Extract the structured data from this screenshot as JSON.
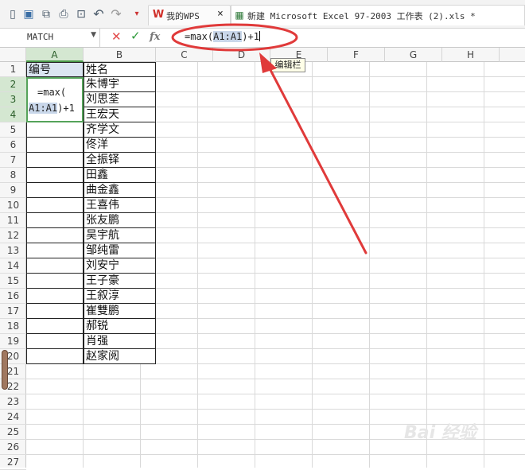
{
  "toolbar": {
    "icons": [
      "new-doc-icon",
      "save-icon",
      "print-preview-icon",
      "export-icon",
      "print-icon",
      "undo-icon",
      "redo-icon",
      "dropdown-icon",
      "wps-logo-icon"
    ],
    "tabs": [
      {
        "label": "我的WPS",
        "close": "×"
      },
      {
        "label": "新建 Microsoft Excel 97-2003 工作表 (2).xls *"
      }
    ]
  },
  "formula_bar": {
    "name_box": "MATCH",
    "cancel": "✕",
    "enter": "✓",
    "fx": "fx",
    "formula_prefix": "=max(",
    "formula_ref": "A1:A1",
    "formula_suffix": ")+1"
  },
  "tooltip": "编辑栏",
  "columns": [
    "A",
    "B",
    "C",
    "D",
    "E",
    "F",
    "G",
    "H"
  ],
  "rows": [
    "1",
    "2",
    "3",
    "4",
    "5",
    "6",
    "7",
    "8",
    "9",
    "10",
    "11",
    "12",
    "13",
    "14",
    "15",
    "16",
    "17",
    "18",
    "19",
    "20",
    "21",
    "22",
    "23",
    "24",
    "25",
    "26",
    "27"
  ],
  "cells": {
    "a1": "编号",
    "edit_line1": "=max(",
    "edit_ref": "A1:A1",
    "edit_suffix": ")+1",
    "b_column": [
      "姓名",
      "朱博宇",
      "刘思荃",
      "王宏天",
      "齐学文",
      "佟洋",
      "全振铎",
      "田鑫",
      "曲金鑫",
      "王喜伟",
      "张友鹏",
      "吴宇航",
      "邹纯雷",
      "刘安宁",
      "王子豪",
      "王叙淳",
      "崔雙鹏",
      "郝锐",
      "肖强",
      "赵家阅"
    ]
  },
  "watermark": "Bai 经验",
  "colors": {
    "annotation_red": "#e03a3a",
    "selection_green": "#55a35a",
    "ref_highlight": "#c9d7ea"
  }
}
